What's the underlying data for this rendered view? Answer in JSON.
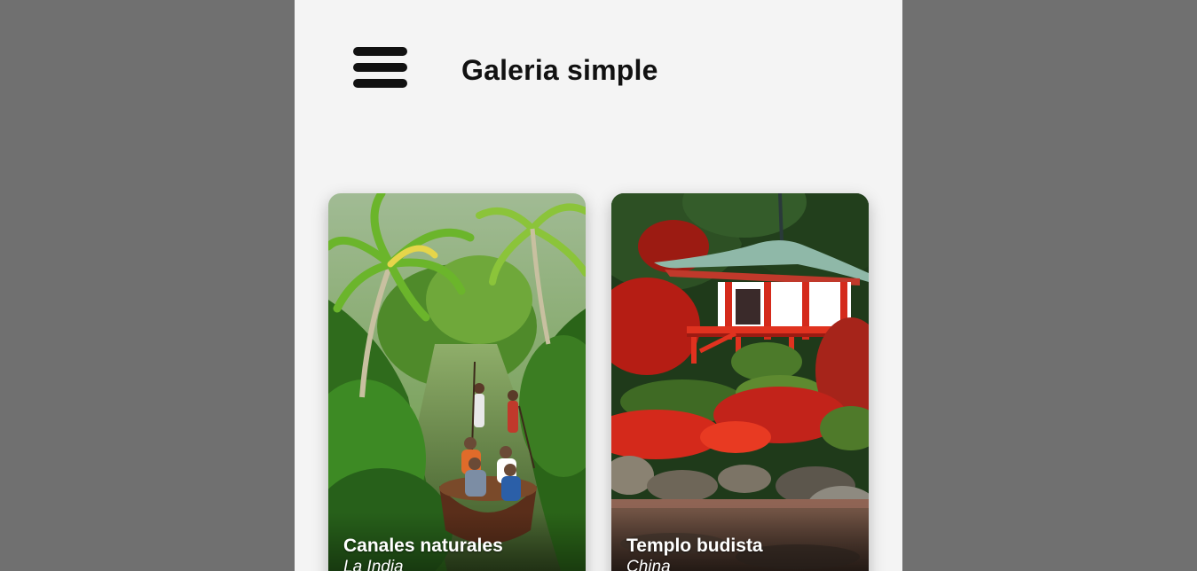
{
  "header": {
    "menu_icon": "hamburger-menu-icon",
    "title": "Galeria simple"
  },
  "gallery": {
    "cards": [
      {
        "title": "Canales naturales",
        "subtitle": "La India",
        "image": "backwater-canal-boat-photo"
      },
      {
        "title": "Templo budista",
        "subtitle": "China",
        "image": "red-pagoda-temple-photo"
      }
    ]
  },
  "colors": {
    "outer_background": "#707070",
    "panel_background": "#f4f4f4",
    "title_text": "#111111",
    "caption_text": "#ffffff"
  }
}
